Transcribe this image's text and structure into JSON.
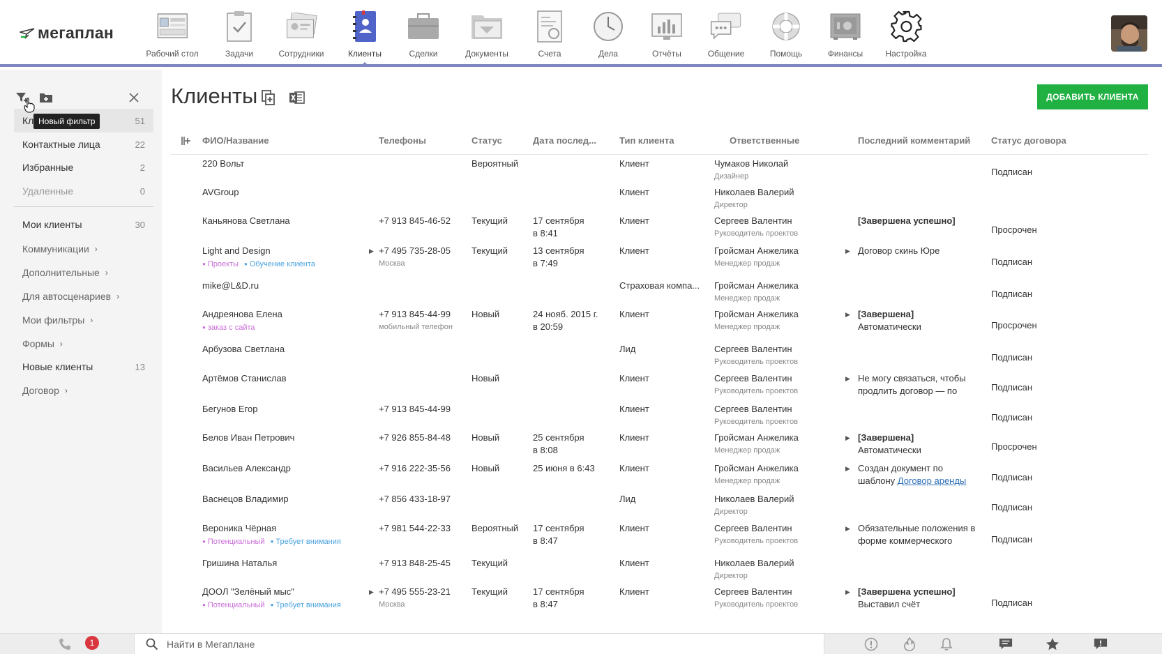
{
  "app": {
    "logo_text": "мегаплан"
  },
  "nav": [
    {
      "label": "Рабочий стол",
      "icon": "desktop-icon"
    },
    {
      "label": "Задачи",
      "icon": "tasks-icon"
    },
    {
      "label": "Сотрудники",
      "icon": "employees-icon"
    },
    {
      "label": "Клиенты",
      "icon": "clients-icon",
      "active": true
    },
    {
      "label": "Сделки",
      "icon": "deals-icon"
    },
    {
      "label": "Документы",
      "icon": "documents-icon"
    },
    {
      "label": "Счета",
      "icon": "invoices-icon"
    },
    {
      "label": "Дела",
      "icon": "clock-icon"
    },
    {
      "label": "Отчёты",
      "icon": "reports-icon"
    },
    {
      "label": "Общение",
      "icon": "chat-icon"
    },
    {
      "label": "Помощь",
      "icon": "lifebuoy-icon"
    },
    {
      "label": "Финансы",
      "icon": "safe-icon"
    },
    {
      "label": "Настройка",
      "icon": "gear-icon"
    }
  ],
  "sidebar": {
    "tooltip": "Новый фильтр",
    "items": [
      {
        "label": "Клиенты",
        "count": "51",
        "active": true
      },
      {
        "label": "Контактные лица",
        "count": "22"
      },
      {
        "label": "Избранные",
        "count": "2"
      },
      {
        "label": "Удаленные",
        "count": "0",
        "muted": true
      }
    ],
    "groups": [
      {
        "label": "Мои клиенты",
        "count": "30"
      },
      {
        "label": "Коммуникации",
        "chevron": "›"
      },
      {
        "label": "Дополнительные",
        "chevron": "›"
      },
      {
        "label": "Для автосценариев",
        "chevron": "›"
      },
      {
        "label": "Мои фильтры",
        "chevron": "›"
      },
      {
        "label": "Формы",
        "chevron": "›"
      },
      {
        "label": "Новые клиенты",
        "count": "13"
      },
      {
        "label": "Договор",
        "chevron": "›"
      }
    ]
  },
  "main": {
    "title": "Клиенты",
    "add_button": "ДОБАВИТЬ КЛИЕНТА",
    "columns": [
      "ФИО/Название",
      "Телефоны",
      "Статус",
      "Дата послед...",
      "Тип клиента",
      "Ответственные",
      "Последний комментарий",
      "Статус договора"
    ]
  },
  "rows": [
    {
      "name": "220 Вольт",
      "tags": [],
      "phone": "",
      "phone_note": "",
      "status": "Вероятный",
      "date1": "",
      "date2": "",
      "type": "Клиент",
      "resp": "Чумаков Николай",
      "role": "Дизайнер",
      "comment1": "",
      "comment2": "",
      "contract": "Подписан"
    },
    {
      "name": "AVGroup",
      "tags": [],
      "phone": "",
      "phone_note": "",
      "status": "",
      "date1": "",
      "date2": "",
      "type": "Клиент",
      "resp": "Николаев Валерий",
      "role": "Директор",
      "comment1": "",
      "comment2": "",
      "contract": ""
    },
    {
      "name": "Каньянова Светлана",
      "tags": [],
      "phone": "+7 913 845-46-52",
      "phone_note": "",
      "status": "Текущий",
      "date1": "17 сентября",
      "date2": "в 8:41",
      "type": "Клиент",
      "resp": "Сергеев Валентин",
      "role": "Руководитель проектов",
      "comment1": "[Завершена успешно]",
      "comment1_bold": true,
      "comment2": "",
      "contract": "Просрочен"
    },
    {
      "name": "Light and Design",
      "name_expander": true,
      "tags": [
        {
          "text": "Проекты",
          "color": "#c86ed8"
        },
        {
          "text": "Обучение клиента",
          "color": "#4aa3df"
        }
      ],
      "phone": "+7 495 735-28-05",
      "phone_note": "Москва",
      "status": "Текущий",
      "date1": "13 сентября",
      "date2": "в 7:49",
      "type": "Клиент",
      "resp": "Гройсман Анжелика",
      "role": "Менеджер продаж",
      "comment_expander": true,
      "comment1": "Договор скинь Юре",
      "comment2": "",
      "contract": "Подписан"
    },
    {
      "name": "mike@L&D.ru",
      "tags": [],
      "phone": "",
      "phone_note": "",
      "status": "",
      "date1": "",
      "date2": "",
      "type": "Страховая компа...",
      "resp": "Гройсман Анжелика",
      "role": "Менеджер продаж",
      "comment1": "",
      "comment2": "",
      "contract": "Подписан"
    },
    {
      "name": "Андреянова Елена",
      "tags": [
        {
          "text": "заказ с сайта",
          "color": "#c86ed8"
        }
      ],
      "phone": "+7 913 845-44-99",
      "phone_note": "мобильный телефон",
      "status": "Новый",
      "date1": "24 нояб. 2015 г.",
      "date2": "в 20:59",
      "type": "Клиент",
      "resp": "Гройсман Анжелика",
      "role": "Менеджер продаж",
      "comment_expander": true,
      "comment1": "[Завершена]",
      "comment1_bold": true,
      "comment2": "Автоматически",
      "contract": "Просрочен"
    },
    {
      "name": "Арбузова Светлана",
      "tags": [],
      "phone": "",
      "phone_note": "",
      "status": "",
      "date1": "",
      "date2": "",
      "type": "Лид",
      "resp": "Сергеев Валентин",
      "role": "Руководитель проектов",
      "comment1": "",
      "comment2": "",
      "contract": "Подписан"
    },
    {
      "name": "Артёмов Станислав",
      "tags": [],
      "phone": "",
      "phone_note": "",
      "status": "Новый",
      "date1": "",
      "date2": "",
      "type": "Клиент",
      "resp": "Сергеев Валентин",
      "role": "Руководитель проектов",
      "comment_expander": true,
      "comment1": "Не могу связаться, чтобы",
      "comment2": "продлить договор — по",
      "contract": "Подписан"
    },
    {
      "name": "Бегунов Егор",
      "tags": [],
      "phone": "+7 913 845-44-99",
      "phone_note": "",
      "status": "",
      "date1": "",
      "date2": "",
      "type": "Клиент",
      "resp": "Сергеев Валентин",
      "role": "Руководитель проектов",
      "comment1": "",
      "comment2": "",
      "contract": "Подписан"
    },
    {
      "name": "Белов Иван Петрович",
      "tags": [],
      "phone": "+7 926 855-84-48",
      "phone_note": "",
      "status": "Новый",
      "date1": "25 сентября",
      "date2": "в 8:08",
      "type": "Клиент",
      "resp": "Гройсман Анжелика",
      "role": "Менеджер продаж",
      "comment_expander": true,
      "comment1": "[Завершена]",
      "comment1_bold": true,
      "comment2": "Автоматически",
      "contract": "Просрочен"
    },
    {
      "name": "Васильев Александр",
      "tags": [],
      "phone": "+7 916 222-35-56",
      "phone_note": "",
      "status": "Новый",
      "date1": "25 июня в 6:43",
      "date2": "",
      "type": "Клиент",
      "resp": "Гройсман Анжелика",
      "role": "Менеджер продаж",
      "comment_expander": true,
      "comment1": "Создан документ по",
      "comment2": "шаблону ",
      "comment_link": "Договор аренды",
      "contract": "Подписан"
    },
    {
      "name": "Васнецов Владимир",
      "tags": [],
      "phone": "+7 856 433-18-97",
      "phone_note": "",
      "status": "",
      "date1": "",
      "date2": "",
      "type": "Лид",
      "resp": "Николаев Валерий",
      "role": "Директор",
      "comment1": "",
      "comment2": "",
      "contract": "Подписан"
    },
    {
      "name": "Вероника Чёрная",
      "tags": [
        {
          "text": "Потенциальный",
          "color": "#c86ed8"
        },
        {
          "text": "Требует внимания",
          "color": "#4aa3df"
        }
      ],
      "phone": "+7 981 544-22-33",
      "phone_note": "",
      "status": "Вероятный",
      "date1": "17 сентября",
      "date2": "в 8:47",
      "type": "Клиент",
      "resp": "Сергеев Валентин",
      "role": "Руководитель проектов",
      "comment_expander": true,
      "comment1": "Обязательные положения в",
      "comment2": "форме коммерческого",
      "contract": "Подписан"
    },
    {
      "name": "Гришина Наталья",
      "tags": [],
      "phone": "+7 913 848-25-45",
      "phone_note": "",
      "status": "Текущий",
      "date1": "",
      "date2": "",
      "type": "Клиент",
      "resp": "Николаев Валерий",
      "role": "Директор",
      "comment1": "",
      "comment2": "",
      "contract": ""
    },
    {
      "name": "ДООЛ \"Зелёный мыс\"",
      "name_expander": true,
      "tags": [
        {
          "text": "Потенциальный",
          "color": "#c86ed8"
        },
        {
          "text": "Требует внимания",
          "color": "#4aa3df"
        }
      ],
      "phone": "+7 495 555-23-21",
      "phone_note": "Москва",
      "status": "Текущий",
      "date1": "17 сентября",
      "date2": "в 8:47",
      "type": "Клиент",
      "resp": "Сергеев Валентин",
      "role": "Руководитель проектов",
      "comment_expander": true,
      "comment1": "[Завершена успешно]",
      "comment1_bold": true,
      "comment2": "Выставил счёт",
      "contract": "Подписан"
    }
  ],
  "bottom": {
    "badge": "1",
    "search_placeholder": "Найти в Мегаплане"
  },
  "colors": {
    "accent": "#7d86bf",
    "primary_button": "#20b142",
    "badge": "#d9363e"
  }
}
